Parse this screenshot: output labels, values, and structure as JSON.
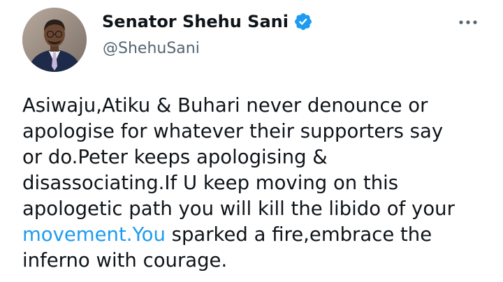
{
  "author": {
    "display_name": "Senator Shehu Sani",
    "handle": "@ShehuSani",
    "verified_icon": "verified-badge-icon",
    "verified_color": "#1d9bf0"
  },
  "more_icon": "more-options-icon",
  "tweet": {
    "lines": [
      "Asiwaju,Atiku & Buhari never denounce or",
      "apologise for whatever their supporters say",
      "or do.Peter keeps apologising &",
      "disassociating.If U keep moving on this",
      "apologetic path you will kill the libido of your"
    ],
    "link_text": "movement.You",
    "after_link": " sparked a fire,embrace the",
    "last_line": "inferno with courage."
  },
  "colors": {
    "text": "#0f1419",
    "secondary": "#536471",
    "link": "#1d9bf0"
  }
}
